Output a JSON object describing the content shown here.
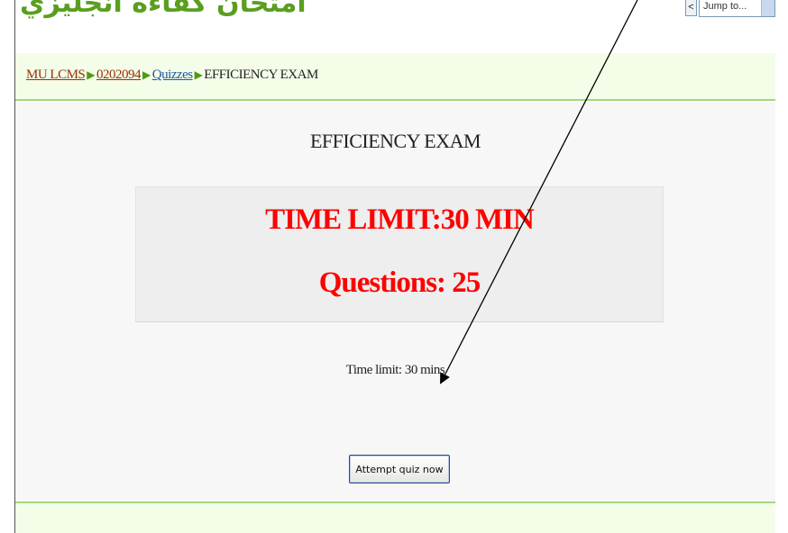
{
  "site": {
    "title": "امتحان كفاءه انجليزي"
  },
  "jump_menu": {
    "button_label": "<",
    "placeholder": "Jump to..."
  },
  "breadcrumb": {
    "items": [
      {
        "label": "MU LCMS",
        "link": true
      },
      {
        "label": "0202094",
        "link": true
      },
      {
        "label": "Quizzes",
        "link": true
      },
      {
        "label": "EFFICIENCY EXAM",
        "link": false
      }
    ],
    "separator": "▶"
  },
  "quiz": {
    "title": "EFFICIENCY EXAM",
    "intro_line_1": "TIME LIMIT:30 MIN",
    "intro_line_2": "Questions: 25",
    "time_limit_text": "Time limit: 30 mins",
    "attempt_button": "Attempt quiz now"
  },
  "colors": {
    "brand_green": "#5a9e1f",
    "nav_bg": "#f3fde8",
    "nav_border": "#a7d67d",
    "alert_red": "#ff0000",
    "arrow": "#000000"
  },
  "annotation": {
    "icon": "arrow-pointer-icon"
  }
}
